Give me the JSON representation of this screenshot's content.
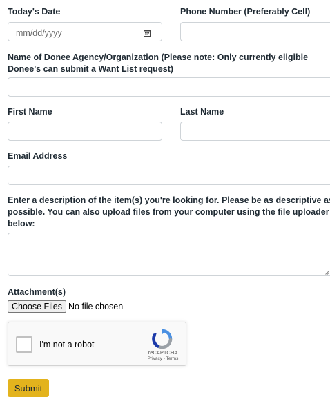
{
  "form": {
    "date_label": "Today's Date",
    "date_placeholder": "mm/dd/yyyy",
    "phone_label": "Phone Number (Preferably Cell)",
    "phone_value": "",
    "agency_label_line1": "Name of Donee Agency/Organization (Please note: Only currently eligible",
    "agency_label_line2": "Donee's can submit a Want List request)",
    "agency_value": "",
    "first_name_label": "First Name",
    "first_name_value": "",
    "last_name_label": "Last Name",
    "last_name_value": "",
    "email_label": "Email Address",
    "email_value": "",
    "description_label_line1": "Enter a description of the item(s) you're looking for. Please be as descriptive as",
    "description_label_line2": "possible. You can also upload files from your computer using the file uploader",
    "description_label_line3": "below:",
    "description_value": "",
    "attachments_label": "Attachment(s)",
    "choose_files_label": "Choose Files",
    "file_status": "No file chosen",
    "submit_label": "Submit"
  },
  "captcha": {
    "label": "I'm not a robot",
    "brand": "reCAPTCHA",
    "links": "Privacy - Terms",
    "logo_icon": "recaptcha-logo-icon"
  },
  "colors": {
    "submit_bg": "#e3b31d",
    "text": "#1f2a33",
    "border": "#cfd4d8"
  }
}
